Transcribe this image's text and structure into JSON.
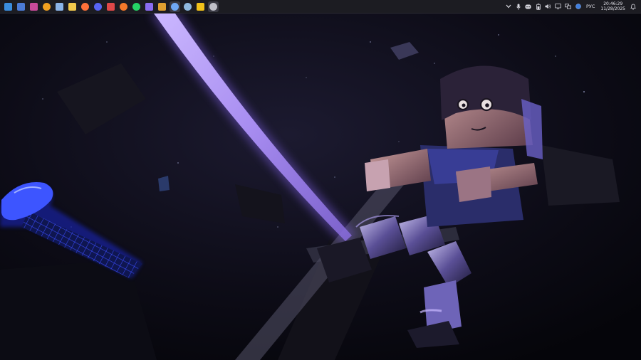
{
  "taskbar": {
    "apps": [
      {
        "name": "start-icon",
        "color": "#3a8dde"
      },
      {
        "name": "widgets-icon",
        "color": "#4b7bd6"
      },
      {
        "name": "apps-icon",
        "color": "#c84a9a"
      },
      {
        "name": "search-icon",
        "color": "#f0a020"
      },
      {
        "name": "save-icon",
        "color": "#8ab4e8"
      },
      {
        "name": "file-explorer-icon",
        "color": "#f2c94c"
      },
      {
        "name": "firefox-icon",
        "color": "#ff7139"
      },
      {
        "name": "discord-icon",
        "color": "#5865f2"
      },
      {
        "name": "app-red-icon",
        "color": "#e04848"
      },
      {
        "name": "blender-icon",
        "color": "#f5792a"
      },
      {
        "name": "whatsapp-icon",
        "color": "#25d366"
      },
      {
        "name": "app-purple-icon",
        "color": "#8a6cf0"
      },
      {
        "name": "app-shield-icon",
        "color": "#e0a030"
      },
      {
        "name": "chrome-icon",
        "color": "#6fa8f5"
      },
      {
        "name": "steam-icon",
        "color": "#8fb8de"
      },
      {
        "name": "app-bars-icon",
        "color": "#f2c21a"
      },
      {
        "name": "obs-icon",
        "color": "#bfbfc8"
      }
    ],
    "tray": {
      "language": "РУС",
      "time": "20:46:29",
      "date": "11/28/2025"
    }
  }
}
